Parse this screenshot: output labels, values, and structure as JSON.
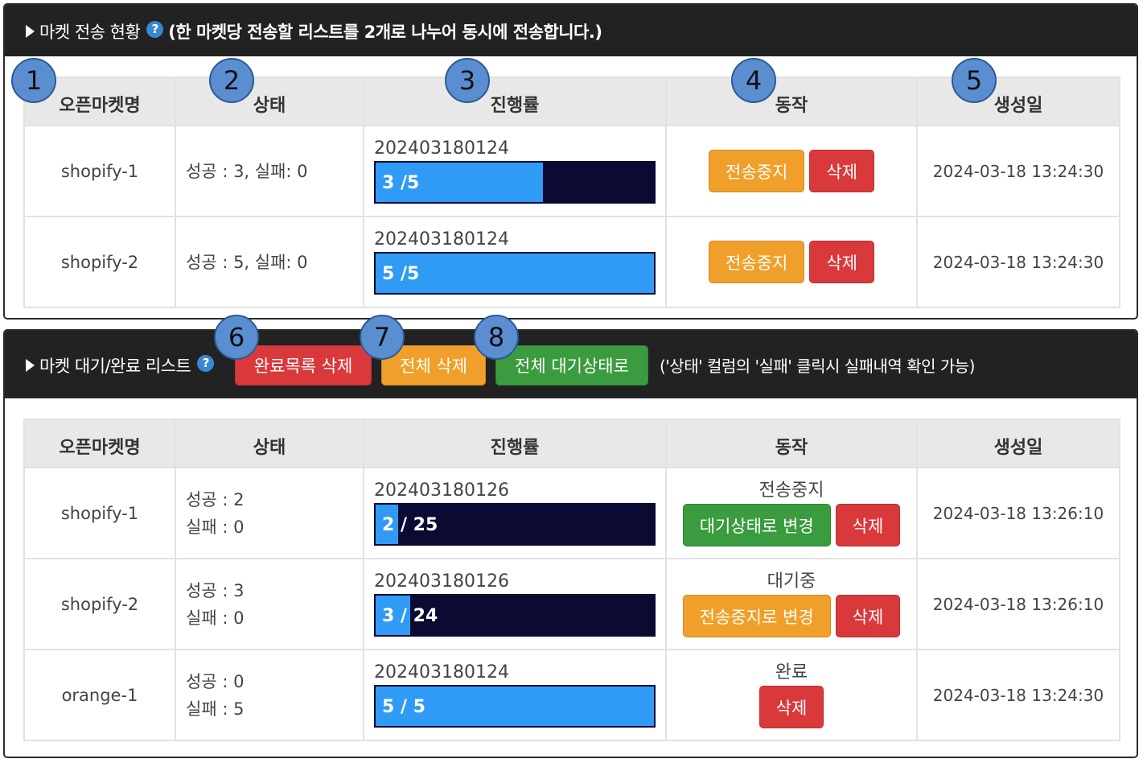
{
  "send_status": {
    "title": "마켓 전송 현황",
    "note": "(한 마켓당 전송할 리스트를 2개로 나누어 동시에 전송합니다.)",
    "help_icon": "?",
    "columns": [
      "오픈마켓명",
      "상태",
      "진행률",
      "동작",
      "생성일"
    ],
    "rows": [
      {
        "name": "shopify-1",
        "status": "성공 : 3, 실패: 0",
        "prog_id": "202403180124",
        "prog_text": "3 /5",
        "progress": 0.6,
        "stop_label": "전송중지",
        "delete_label": "삭제",
        "date": "2024-03-18 13:24:30"
      },
      {
        "name": "shopify-2",
        "status": "성공 : 5, 실패: 0",
        "prog_id": "202403180124",
        "prog_text": "5 /5",
        "progress": 1.0,
        "stop_label": "전송중지",
        "delete_label": "삭제",
        "date": "2024-03-18 13:24:30"
      }
    ]
  },
  "queue_list": {
    "title": "마켓 대기/완료 리스트",
    "help_icon": "?",
    "delete_done_label": "완료목록 삭제",
    "delete_all_label": "전체 삭제",
    "all_wait_label": "전체 대기상태로",
    "note": "('상태' 컬럼의 '실패' 클릭시 실패내역 확인 가능)",
    "columns": [
      "오픈마켓명",
      "상태",
      "진행률",
      "동작",
      "생성일"
    ],
    "rows": [
      {
        "name": "shopify-1",
        "success": "성공 : 2",
        "fail": "실패 : 0",
        "prog_id": "202403180126",
        "prog_text": "2 / 25",
        "progress": 0.08,
        "state": "전송중지",
        "action_label": "대기상태로 변경",
        "action_color": "green",
        "delete_label": "삭제",
        "date": "2024-03-18 13:26:10"
      },
      {
        "name": "shopify-2",
        "success": "성공 : 3",
        "fail": "실패 : 0",
        "prog_id": "202403180126",
        "prog_text": "3 / 24",
        "progress": 0.125,
        "state": "대기중",
        "action_label": "전송중지로 변경",
        "action_color": "orange",
        "delete_label": "삭제",
        "date": "2024-03-18 13:26:10"
      },
      {
        "name": "orange-1",
        "success": "성공 : 0",
        "fail": "실패 : 5",
        "prog_id": "202403180124",
        "prog_text": "5 / 5",
        "progress": 1.0,
        "state": "완료",
        "action_label": "",
        "action_color": "",
        "delete_label": "삭제",
        "date": "2024-03-18 13:24:30"
      }
    ]
  },
  "badges": [
    "1",
    "2",
    "3",
    "4",
    "5",
    "6",
    "7",
    "8"
  ],
  "colors": {
    "header_bg": "#222222",
    "bar_bg": "#0a0a33",
    "bar_fill": "#2f9bf5",
    "red": "#d9393a",
    "orange": "#f0a02a",
    "green": "#3a9c3e",
    "badge": "#5b8ed0"
  }
}
